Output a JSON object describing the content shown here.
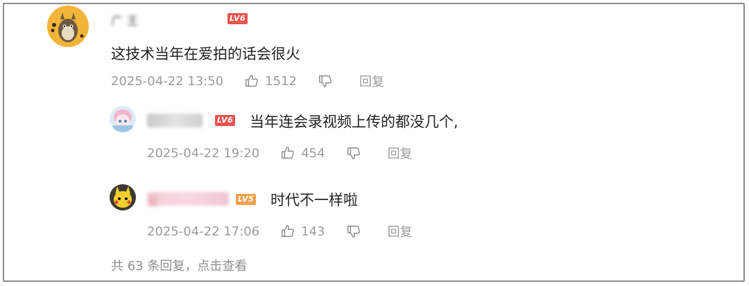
{
  "colors": {
    "lv6_badge": "#e8554e",
    "lv5_badge": "#f0a04c",
    "meta_text": "#9b9b9b",
    "content_text": "#222222",
    "frame_border": "#8a8a8a"
  },
  "comment": {
    "username": "广 王",
    "level_badge": "LV6",
    "text": "这技术当年在爱拍的话会很火",
    "timestamp": "2025-04-22 13:50",
    "like_count": "1512",
    "like_icon": "thumbs-up-icon",
    "dislike_icon": "thumbs-down-icon",
    "reply_label": "回复",
    "replies": [
      {
        "username": "",
        "level_badge": "LV6",
        "text": "当年连会录视频上传的都没几个,",
        "timestamp": "2025-04-22 19:20",
        "like_count": "454",
        "reply_label": "回复"
      },
      {
        "username": "爱",
        "level_badge": "LV5",
        "text": "时代不一样啦",
        "timestamp": "2025-04-22 17:06",
        "like_count": "143",
        "reply_label": "回复"
      }
    ],
    "view_more": "共 63 条回复，点击查看"
  }
}
